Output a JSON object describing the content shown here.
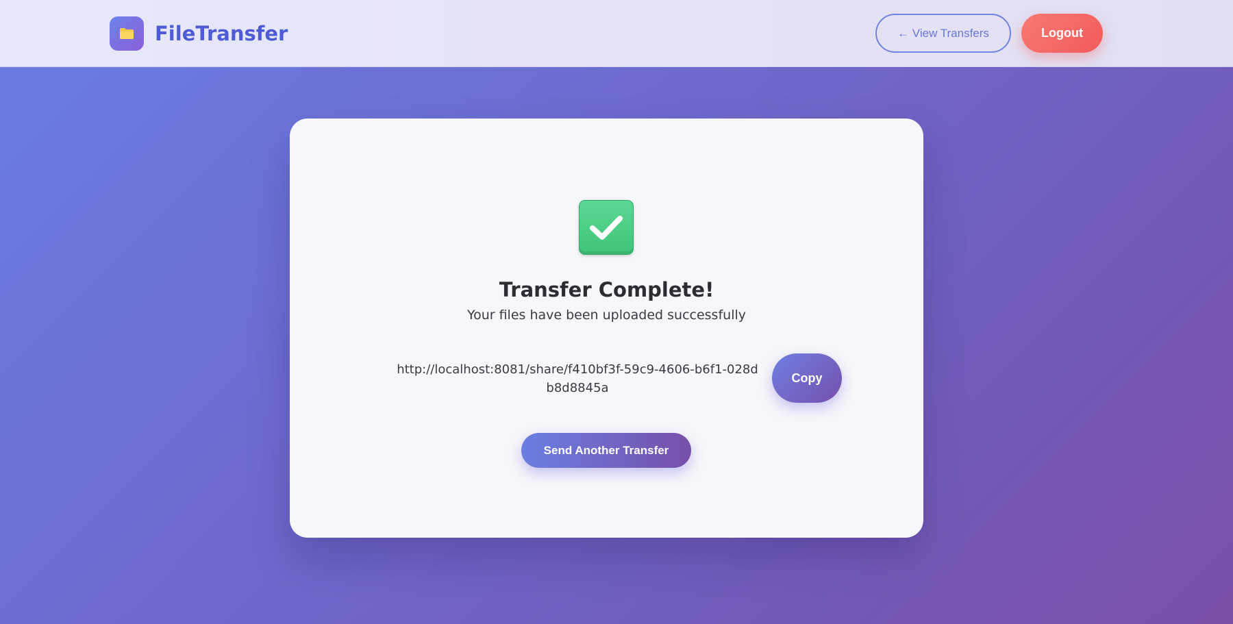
{
  "header": {
    "brand_name": "FileTransfer",
    "brand_icon": "folder-icon",
    "view_transfers_label": "← View Transfers",
    "logout_label": "Logout"
  },
  "result": {
    "status_icon": "check-mark-icon",
    "title": "Transfer Complete!",
    "subtitle": "Your files have been uploaded successfully",
    "share_link": "http://localhost:8081/share/f410bf3f-59c9-4606-b6f1-028db8d8845a",
    "copy_label": "Copy",
    "send_another_label": "Send Another Transfer"
  },
  "colors": {
    "accent": "#6a7fe2",
    "logout": "#f25a5a",
    "success": "#45c97f"
  }
}
